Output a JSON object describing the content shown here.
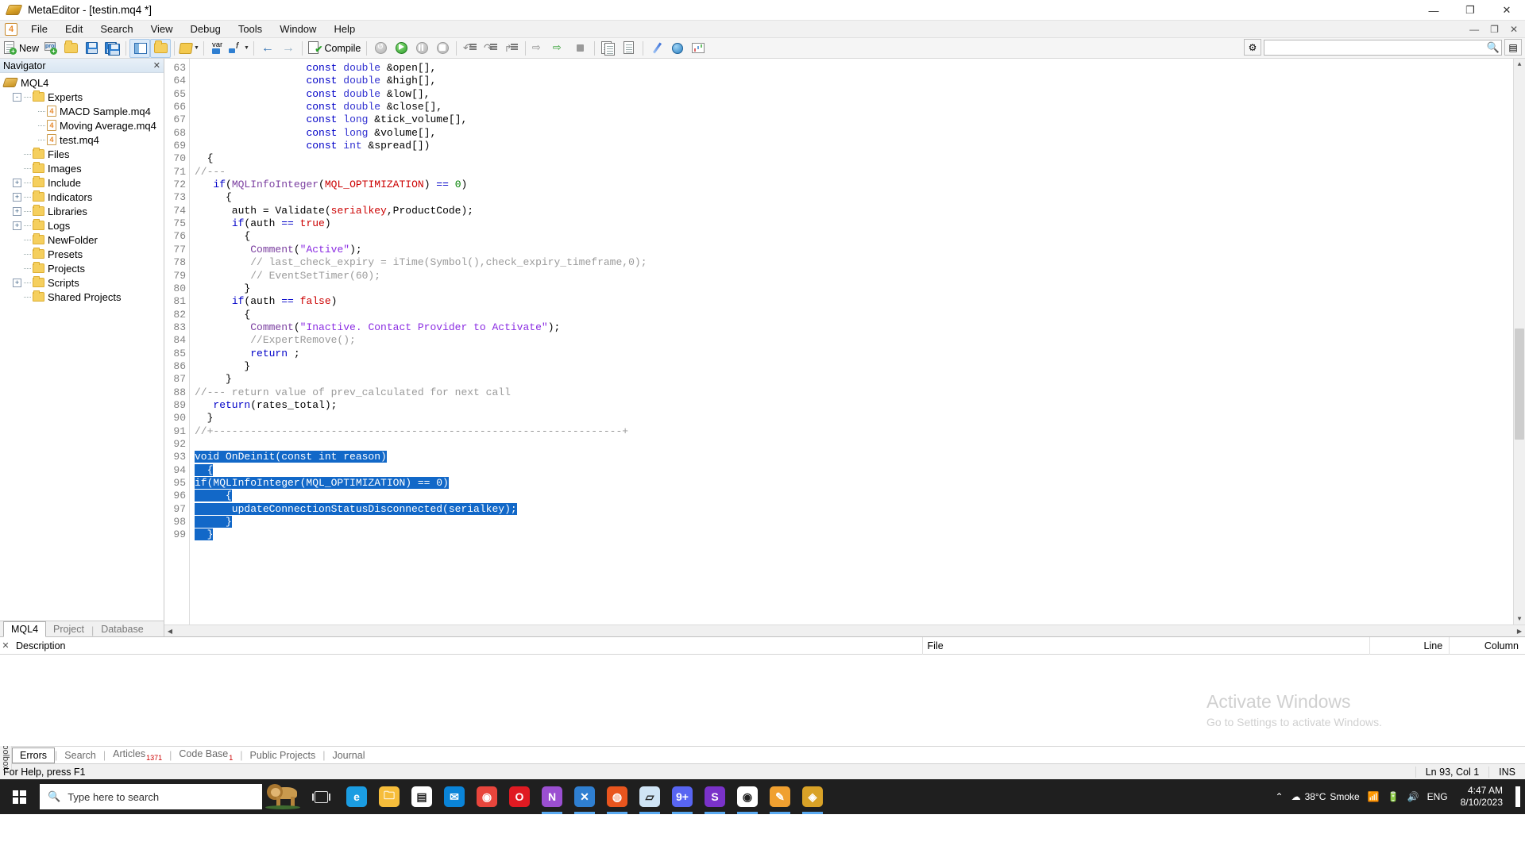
{
  "window": {
    "title": "MetaEditor - [testin.mq4 *]",
    "app_icon": "metaeditor-diamond-icon",
    "minimize": "—",
    "maximize": "❐",
    "close": "✕"
  },
  "menubar": {
    "app_badge": "4",
    "items": [
      "File",
      "Edit",
      "Search",
      "View",
      "Debug",
      "Tools",
      "Window",
      "Help"
    ],
    "doc_minimize": "—",
    "doc_restore": "❐",
    "doc_close": "✕"
  },
  "toolbar": {
    "new_label": "New",
    "compile_label": "Compile",
    "buttons": [
      "new-file-button",
      "new-project-button",
      "open-file-button",
      "save-button",
      "save-all-button",
      "navigator-toggle-button",
      "toolbox-toggle-button",
      "styler-button",
      "variables-button",
      "functions-button",
      "back-button",
      "forward-button",
      "compile-button",
      "restart-button",
      "start-button",
      "pause-button",
      "stop-button",
      "step-into-button",
      "step-over-button",
      "step-out-button",
      "run-to-cursor-button",
      "run-button",
      "stop-debug-button",
      "copy-button",
      "paste-button",
      "magic-wand-button",
      "globe-button",
      "chart-button"
    ],
    "search_placeholder": "",
    "search_value": "",
    "search_icon": "search-icon",
    "settings_icon": "gear-icon"
  },
  "navigator": {
    "title": "Navigator",
    "close_icon": "✕",
    "root": "MQL4",
    "items": [
      {
        "label": "Experts",
        "type": "folder",
        "expander": "-",
        "depth": 1
      },
      {
        "label": "MACD Sample.mq4",
        "type": "file",
        "expander": "",
        "depth": 2
      },
      {
        "label": "Moving Average.mq4",
        "type": "file",
        "expander": "",
        "depth": 2
      },
      {
        "label": "test.mq4",
        "type": "file",
        "expander": "",
        "depth": 2
      },
      {
        "label": "Files",
        "type": "folder",
        "expander": "",
        "depth": 1
      },
      {
        "label": "Images",
        "type": "folder",
        "expander": "",
        "depth": 1
      },
      {
        "label": "Include",
        "type": "folder",
        "expander": "+",
        "depth": 1
      },
      {
        "label": "Indicators",
        "type": "folder",
        "expander": "+",
        "depth": 1
      },
      {
        "label": "Libraries",
        "type": "folder",
        "expander": "+",
        "depth": 1
      },
      {
        "label": "Logs",
        "type": "folder",
        "expander": "+",
        "depth": 1
      },
      {
        "label": "NewFolder",
        "type": "folder",
        "expander": "",
        "depth": 1
      },
      {
        "label": "Presets",
        "type": "folder",
        "expander": "",
        "depth": 1
      },
      {
        "label": "Projects",
        "type": "folder",
        "expander": "",
        "depth": 1
      },
      {
        "label": "Scripts",
        "type": "folder",
        "expander": "+",
        "depth": 1
      },
      {
        "label": "Shared Projects",
        "type": "folder",
        "expander": "",
        "depth": 1
      }
    ],
    "tabs": [
      {
        "label": "MQL4",
        "selected": true
      },
      {
        "label": "Project",
        "selected": false
      },
      {
        "label": "Database",
        "selected": false
      }
    ]
  },
  "editor": {
    "first_line": 63,
    "lines": [
      {
        "n": 63,
        "selected": false,
        "tokens": [
          {
            "t": "                  ",
            "c": "pl"
          },
          {
            "t": "const",
            "c": "k"
          },
          {
            "t": " ",
            "c": "pl"
          },
          {
            "t": "double",
            "c": "ty"
          },
          {
            "t": " &open[],",
            "c": "pl"
          }
        ]
      },
      {
        "n": 64,
        "selected": false,
        "tokens": [
          {
            "t": "                  ",
            "c": "pl"
          },
          {
            "t": "const",
            "c": "k"
          },
          {
            "t": " ",
            "c": "pl"
          },
          {
            "t": "double",
            "c": "ty"
          },
          {
            "t": " &high[],",
            "c": "pl"
          }
        ]
      },
      {
        "n": 65,
        "selected": false,
        "tokens": [
          {
            "t": "                  ",
            "c": "pl"
          },
          {
            "t": "const",
            "c": "k"
          },
          {
            "t": " ",
            "c": "pl"
          },
          {
            "t": "double",
            "c": "ty"
          },
          {
            "t": " &low[],",
            "c": "pl"
          }
        ]
      },
      {
        "n": 66,
        "selected": false,
        "tokens": [
          {
            "t": "                  ",
            "c": "pl"
          },
          {
            "t": "const",
            "c": "k"
          },
          {
            "t": " ",
            "c": "pl"
          },
          {
            "t": "double",
            "c": "ty"
          },
          {
            "t": " &close[],",
            "c": "pl"
          }
        ]
      },
      {
        "n": 67,
        "selected": false,
        "tokens": [
          {
            "t": "                  ",
            "c": "pl"
          },
          {
            "t": "const",
            "c": "k"
          },
          {
            "t": " ",
            "c": "pl"
          },
          {
            "t": "long",
            "c": "ty"
          },
          {
            "t": " &tick_volume[],",
            "c": "pl"
          }
        ]
      },
      {
        "n": 68,
        "selected": false,
        "tokens": [
          {
            "t": "                  ",
            "c": "pl"
          },
          {
            "t": "const",
            "c": "k"
          },
          {
            "t": " ",
            "c": "pl"
          },
          {
            "t": "long",
            "c": "ty"
          },
          {
            "t": " &volume[],",
            "c": "pl"
          }
        ]
      },
      {
        "n": 69,
        "selected": false,
        "tokens": [
          {
            "t": "                  ",
            "c": "pl"
          },
          {
            "t": "const",
            "c": "k"
          },
          {
            "t": " ",
            "c": "pl"
          },
          {
            "t": "int",
            "c": "ty"
          },
          {
            "t": " &spread[])",
            "c": "pl"
          }
        ]
      },
      {
        "n": 70,
        "selected": false,
        "tokens": [
          {
            "t": "  {",
            "c": "pl"
          }
        ]
      },
      {
        "n": 71,
        "selected": false,
        "tokens": [
          {
            "t": "//---",
            "c": "cm"
          }
        ]
      },
      {
        "n": 72,
        "selected": false,
        "tokens": [
          {
            "t": "   ",
            "c": "pl"
          },
          {
            "t": "if",
            "c": "k"
          },
          {
            "t": "(",
            "c": "pl"
          },
          {
            "t": "MQLInfoInteger",
            "c": "fn"
          },
          {
            "t": "(",
            "c": "pl"
          },
          {
            "t": "MQL_OPTIMIZATION",
            "c": "cst"
          },
          {
            "t": ") ",
            "c": "pl"
          },
          {
            "t": "==",
            "c": "k"
          },
          {
            "t": " ",
            "c": "pl"
          },
          {
            "t": "0",
            "c": "num"
          },
          {
            "t": ")",
            "c": "pl"
          }
        ]
      },
      {
        "n": 73,
        "selected": false,
        "tokens": [
          {
            "t": "     {",
            "c": "pl"
          }
        ]
      },
      {
        "n": 74,
        "selected": false,
        "tokens": [
          {
            "t": "      auth = Validate(",
            "c": "pl"
          },
          {
            "t": "serialkey",
            "c": "cst"
          },
          {
            "t": ",ProductCode);",
            "c": "pl"
          }
        ]
      },
      {
        "n": 75,
        "selected": false,
        "tokens": [
          {
            "t": "      ",
            "c": "pl"
          },
          {
            "t": "if",
            "c": "k"
          },
          {
            "t": "(auth ",
            "c": "pl"
          },
          {
            "t": "==",
            "c": "k"
          },
          {
            "t": " ",
            "c": "pl"
          },
          {
            "t": "true",
            "c": "cst"
          },
          {
            "t": ")",
            "c": "pl"
          }
        ]
      },
      {
        "n": 76,
        "selected": false,
        "tokens": [
          {
            "t": "        {",
            "c": "pl"
          }
        ]
      },
      {
        "n": 77,
        "selected": false,
        "tokens": [
          {
            "t": "         ",
            "c": "pl"
          },
          {
            "t": "Comment",
            "c": "fn"
          },
          {
            "t": "(",
            "c": "pl"
          },
          {
            "t": "\"Active\"",
            "c": "str"
          },
          {
            "t": ");",
            "c": "pl"
          }
        ]
      },
      {
        "n": 78,
        "selected": false,
        "tokens": [
          {
            "t": "         // last_check_expiry = iTime(Symbol(),check_expiry_timeframe,0);",
            "c": "cm"
          }
        ]
      },
      {
        "n": 79,
        "selected": false,
        "tokens": [
          {
            "t": "         // EventSetTimer(60);",
            "c": "cm"
          }
        ]
      },
      {
        "n": 80,
        "selected": false,
        "tokens": [
          {
            "t": "        }",
            "c": "pl"
          }
        ]
      },
      {
        "n": 81,
        "selected": false,
        "tokens": [
          {
            "t": "      ",
            "c": "pl"
          },
          {
            "t": "if",
            "c": "k"
          },
          {
            "t": "(auth ",
            "c": "pl"
          },
          {
            "t": "==",
            "c": "k"
          },
          {
            "t": " ",
            "c": "pl"
          },
          {
            "t": "false",
            "c": "cst"
          },
          {
            "t": ")",
            "c": "pl"
          }
        ]
      },
      {
        "n": 82,
        "selected": false,
        "tokens": [
          {
            "t": "        {",
            "c": "pl"
          }
        ]
      },
      {
        "n": 83,
        "selected": false,
        "tokens": [
          {
            "t": "         ",
            "c": "pl"
          },
          {
            "t": "Comment",
            "c": "fn"
          },
          {
            "t": "(",
            "c": "pl"
          },
          {
            "t": "\"Inactive. Contact Provider to Activate\"",
            "c": "str"
          },
          {
            "t": ");",
            "c": "pl"
          }
        ]
      },
      {
        "n": 84,
        "selected": false,
        "tokens": [
          {
            "t": "         //ExpertRemove();",
            "c": "cm"
          }
        ]
      },
      {
        "n": 85,
        "selected": false,
        "tokens": [
          {
            "t": "         ",
            "c": "pl"
          },
          {
            "t": "return",
            "c": "k"
          },
          {
            "t": " ;",
            "c": "pl"
          }
        ]
      },
      {
        "n": 86,
        "selected": false,
        "tokens": [
          {
            "t": "        }",
            "c": "pl"
          }
        ]
      },
      {
        "n": 87,
        "selected": false,
        "tokens": [
          {
            "t": "     }",
            "c": "pl"
          }
        ]
      },
      {
        "n": 88,
        "selected": false,
        "tokens": [
          {
            "t": "//--- return value of prev_calculated for next call",
            "c": "cm"
          }
        ]
      },
      {
        "n": 89,
        "selected": false,
        "tokens": [
          {
            "t": "   ",
            "c": "pl"
          },
          {
            "t": "return",
            "c": "k"
          },
          {
            "t": "(rates_total);",
            "c": "pl"
          }
        ]
      },
      {
        "n": 90,
        "selected": false,
        "tokens": [
          {
            "t": "  }",
            "c": "pl"
          }
        ]
      },
      {
        "n": 91,
        "selected": false,
        "tokens": [
          {
            "t": "//+------------------------------------------------------------------+",
            "c": "cm"
          }
        ]
      },
      {
        "n": 92,
        "selected": false,
        "tokens": [
          {
            "t": "",
            "c": "pl"
          }
        ]
      },
      {
        "n": 93,
        "selected": true,
        "tokens": [
          {
            "t": "void OnDeinit(const int reason)",
            "c": "pl"
          }
        ]
      },
      {
        "n": 94,
        "selected": true,
        "tokens": [
          {
            "t": "  {",
            "c": "pl"
          }
        ]
      },
      {
        "n": 95,
        "selected": true,
        "tokens": [
          {
            "t": "if(MQLInfoInteger(MQL_OPTIMIZATION) == 0)",
            "c": "pl"
          }
        ]
      },
      {
        "n": 96,
        "selected": true,
        "tokens": [
          {
            "t": "     {",
            "c": "pl"
          }
        ]
      },
      {
        "n": 97,
        "selected": true,
        "tokens": [
          {
            "t": "      updateConnectionStatusDisconnected(serialkey);",
            "c": "pl"
          }
        ]
      },
      {
        "n": 98,
        "selected": true,
        "tokens": [
          {
            "t": "     }",
            "c": "pl"
          }
        ]
      },
      {
        "n": 99,
        "selected": true,
        "tokens": [
          {
            "t": "  }",
            "c": "pl"
          }
        ]
      }
    ]
  },
  "toolbox": {
    "vertical_label": "Toolbox",
    "close_icon": "✕",
    "columns": [
      "Description",
      "File",
      "Line",
      "Column"
    ],
    "rows": [],
    "tabs": [
      {
        "label": "Errors",
        "badge": "",
        "selected": true
      },
      {
        "label": "Search",
        "badge": "",
        "selected": false
      },
      {
        "label": "Articles",
        "badge": "1371",
        "selected": false
      },
      {
        "label": "Code Base",
        "badge": "1",
        "selected": false
      },
      {
        "label": "Public Projects",
        "badge": "",
        "selected": false
      },
      {
        "label": "Journal",
        "badge": "",
        "selected": false
      }
    ],
    "watermark_line1": "Activate Windows",
    "watermark_line2": "Go to Settings to activate Windows."
  },
  "statusbar": {
    "hint": "For Help, press F1",
    "line": "Ln 93, Col 1",
    "mode": "INS"
  },
  "taskbar": {
    "search_placeholder": "Type here to search",
    "search_icon": "magnifier-icon",
    "start_icon": "windows-start-icon",
    "taskview_icon": "task-view-icon",
    "apps": [
      {
        "name": "edge-icon",
        "glyph": "e",
        "color": "#1b9de2",
        "active": false
      },
      {
        "name": "file-explorer-icon",
        "glyph": "🗀",
        "color": "#f6bd3b",
        "active": false
      },
      {
        "name": "microsoft-store-icon",
        "glyph": "▤",
        "color": "#ffffff",
        "active": false
      },
      {
        "name": "mail-icon",
        "glyph": "✉",
        "color": "#0a84d8",
        "active": false
      },
      {
        "name": "chrome-icon",
        "glyph": "◉",
        "color": "#e8453c",
        "active": false
      },
      {
        "name": "opera-icon",
        "glyph": "O",
        "color": "#e01a22",
        "active": false
      },
      {
        "name": "visual-studio-icon",
        "glyph": "N",
        "color": "#9b4fd1",
        "active": true
      },
      {
        "name": "vs-code-icon",
        "glyph": "✕",
        "color": "#2f7fd1",
        "active": true
      },
      {
        "name": "ubuntu-icon",
        "glyph": "◍",
        "color": "#e9551e",
        "active": true
      },
      {
        "name": "metatrader-icon",
        "glyph": "▱",
        "color": "#cfe4f5",
        "active": true
      },
      {
        "name": "discord-icon",
        "glyph": "9+",
        "color": "#5865f2",
        "active": true
      },
      {
        "name": "skype-icon",
        "glyph": "S",
        "color": "#7a32c9",
        "active": true
      },
      {
        "name": "github-icon",
        "glyph": "◉",
        "color": "#ffffff",
        "active": true
      },
      {
        "name": "notepad-icon",
        "glyph": "✎",
        "color": "#f0a030",
        "active": true
      },
      {
        "name": "metaeditor-icon",
        "glyph": "◈",
        "color": "#d9a227",
        "active": true
      }
    ],
    "tray": {
      "chevron_icon": "⌃",
      "weather_temp": "38°C",
      "weather_desc": "Smoke",
      "weather_icon": "cloud-icon",
      "wifi_icon": "wifi-icon",
      "battery_icon": "battery-icon",
      "volume_icon": "speaker-icon",
      "language": "ENG",
      "time": "4:47 AM",
      "date": "8/10/2023",
      "notification_icon": "action-center-icon"
    }
  }
}
